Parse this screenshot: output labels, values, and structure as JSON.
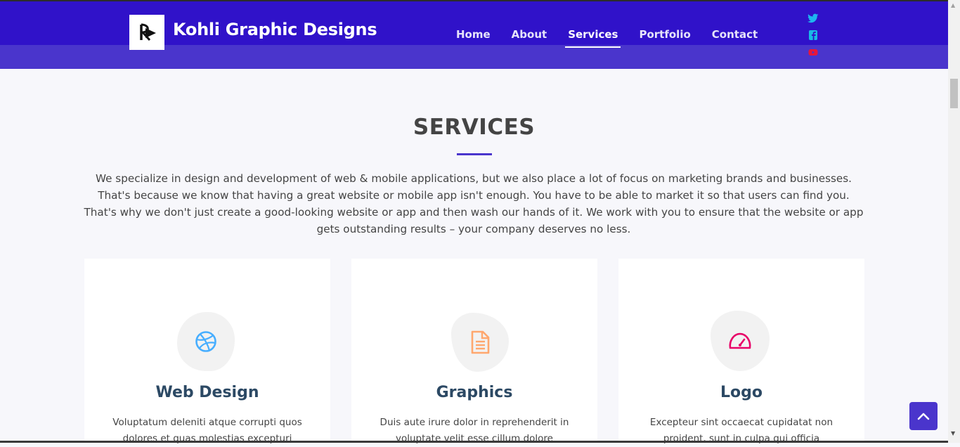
{
  "header": {
    "brand": "Kohli Graphic Designs",
    "nav": [
      "Home",
      "About",
      "Services",
      "Portfolio",
      "Contact"
    ],
    "active_nav": "Services",
    "social_icons": [
      "twitter-icon",
      "facebook-icon",
      "youtube-icon"
    ],
    "social_colors": [
      "#1da1f2",
      "#1877f2",
      "#ff0000"
    ]
  },
  "services": {
    "title": "SERVICES",
    "intro": "We specialize in design and development of web & mobile applications, but we also place a lot of focus on marketing brands and businesses. That's because we know that having a great website or mobile app isn't enough. You have to be able to market it so that users can find you. That's why we don't just create a good-looking website or app and then wash our hands of it. We work with you to ensure that the website or app gets outstanding results – your company deserves no less.",
    "cards": [
      {
        "title": "Web Design",
        "text": "Voluptatum deleniti atque corrupti quos dolores et quas molestias excepturi",
        "icon": "dribbble-icon",
        "icon_color": "#47aeff"
      },
      {
        "title": "Graphics",
        "text": "Duis aute irure dolor in reprehenderit in voluptate velit esse cillum dolore",
        "icon": "file-text-icon",
        "icon_color": "#ffa76e"
      },
      {
        "title": "Logo",
        "text": "Excepteur sint occaecat cupidatat non proident, sunt in culpa qui officia",
        "icon": "speedometer-icon",
        "icon_color": "#e80368"
      }
    ]
  },
  "colors": {
    "header_bg": "#3012c9",
    "accent": "#4a35cc",
    "heading": "#2c4964",
    "text": "#444444"
  }
}
